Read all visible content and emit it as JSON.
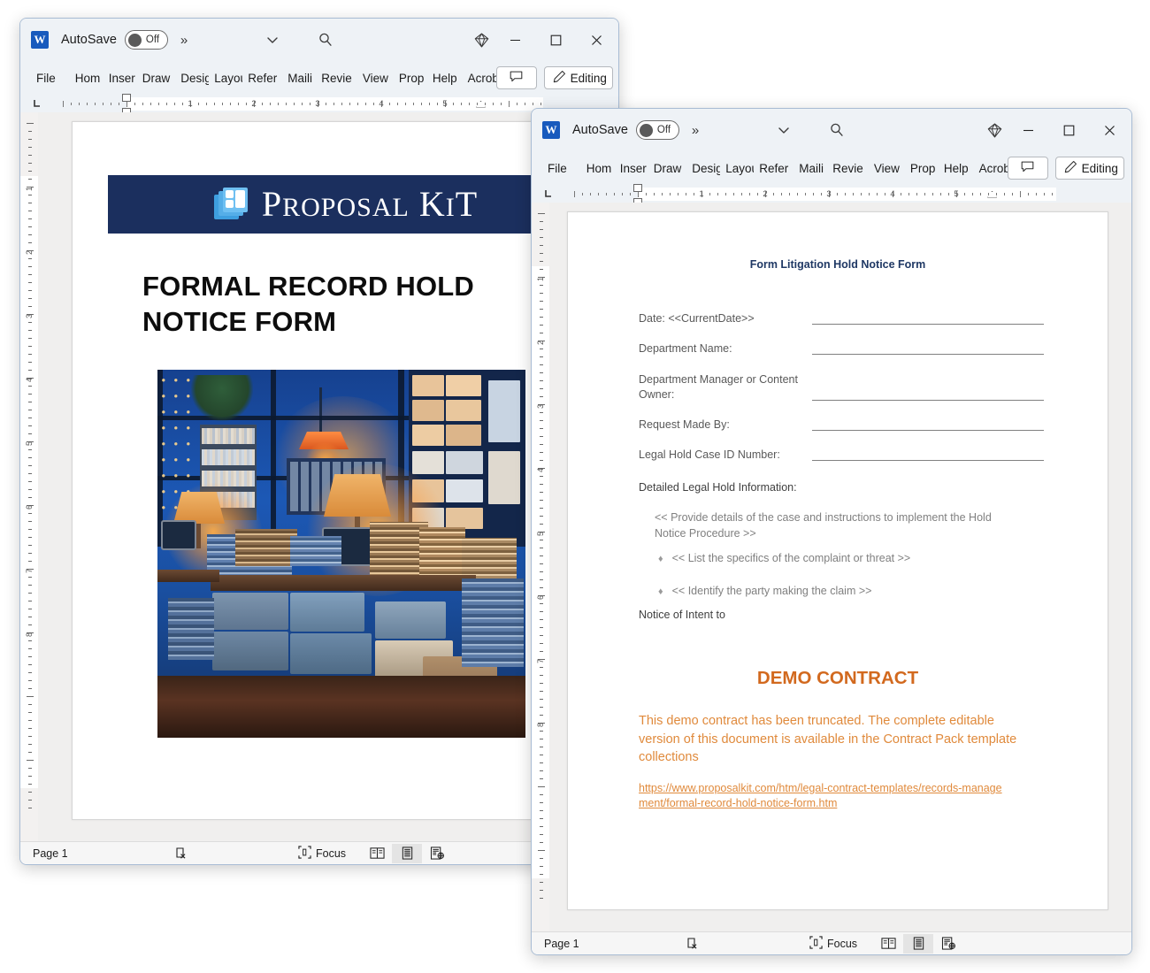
{
  "window1": {
    "titlebar": {
      "app_icon": "word-icon",
      "autosave_label": "AutoSave",
      "autosave_state": "Off",
      "overflow_chevron": "»",
      "customize_icon": "chevron-down-icon",
      "search_icon": "search-icon",
      "copilot_icon": "diamond-icon",
      "minimize_icon": "minimize-icon",
      "maximize_icon": "maximize-icon",
      "close_icon": "close-icon"
    },
    "ribbon": {
      "tabs": [
        "File",
        "Home",
        "Insert",
        "Draw",
        "Design",
        "Layout",
        "References",
        "Mailings",
        "Review",
        "View",
        "Proposal Kit",
        "Help",
        "Acrobat"
      ],
      "tabs_display": [
        "File",
        "Hom",
        "Inser",
        "Draw",
        "Desig",
        "Layou",
        "Refer",
        "Maili",
        "Revie",
        "View",
        "Prop",
        "Help",
        "Acrob"
      ],
      "comments_icon": "comment-icon",
      "editing_icon": "pencil-icon",
      "editing_label": "Editing",
      "more_chevron": "›"
    },
    "ruler": {
      "tabstop_icon": "left-tab-stop-icon",
      "numbers": [
        "1",
        "2",
        "3",
        "4",
        "5"
      ],
      "vertical_numbers": [
        "1",
        "2",
        "3",
        "4",
        "5",
        "6",
        "7",
        "8"
      ]
    },
    "document": {
      "banner_brand": "PROPOSAL KIT",
      "banner_brand_main": "P",
      "title": "FORMAL RECORD HOLD NOTICE FORM",
      "image_alt": "records-archive-photo",
      "banner_color": "#1b2f5e"
    },
    "statusbar": {
      "page_label": "Page 1",
      "spelling_icon": "proofing-icon",
      "focus_icon": "focus-icon",
      "focus_label": "Focus",
      "view_read_icon": "read-mode-icon",
      "view_print_icon": "print-layout-icon",
      "view_web_icon": "web-layout-icon"
    }
  },
  "window2": {
    "titlebar": {
      "app_icon": "word-icon",
      "autosave_label": "AutoSave",
      "autosave_state": "Off",
      "overflow_chevron": "»",
      "customize_icon": "chevron-down-icon",
      "search_icon": "search-icon",
      "copilot_icon": "diamond-icon",
      "minimize_icon": "minimize-icon",
      "maximize_icon": "maximize-icon",
      "close_icon": "close-icon"
    },
    "ribbon": {
      "tabs": [
        "File",
        "Home",
        "Insert",
        "Draw",
        "Design",
        "Layout",
        "References",
        "Mailings",
        "Review",
        "View",
        "Proposal Kit",
        "Help",
        "Acrobat"
      ],
      "tabs_display": [
        "File",
        "Hom",
        "Inser",
        "Draw",
        "Desig",
        "Layou",
        "Refer",
        "Maili",
        "Revie",
        "View",
        "Prop",
        "Help",
        "Acrob"
      ],
      "comments_icon": "comment-icon",
      "editing_icon": "pencil-icon",
      "editing_label": "Editing",
      "more_chevron": "›"
    },
    "ruler": {
      "tabstop_icon": "left-tab-stop-icon",
      "numbers": [
        "1",
        "2",
        "3",
        "4",
        "5"
      ],
      "vertical_numbers": [
        "1",
        "2",
        "3",
        "4",
        "5",
        "6",
        "7",
        "8"
      ]
    },
    "document": {
      "title": "Form Litigation Hold Notice Form",
      "title_color": "#1f3864",
      "fields": [
        {
          "label": "Date: <<CurrentDate>>"
        },
        {
          "label": "Department Name:"
        },
        {
          "label": "Department Manager or Content Owner:"
        },
        {
          "label": "Request Made By:"
        },
        {
          "label": "Legal Hold Case ID Number:"
        }
      ],
      "section_heading": "Detailed Legal Hold Information:",
      "instruction": "<< Provide details of the case and instructions to implement the Hold Notice Procedure >>",
      "bullets": [
        "<< List the specifics of the complaint or threat >>",
        "<< Identify the party making the claim >>"
      ],
      "bullet_char": "♦",
      "closing_heading": "Notice of Intent to",
      "demo_title": "DEMO CONTRACT",
      "demo_text": "This demo contract has been truncated. The complete editable version of this document is available in the Contract Pack template collections",
      "demo_link": "https://www.proposalkit.com/htm/legal-contract-templates/records-management/formal-record-hold-notice-form.htm",
      "demo_color": "#e08a3c",
      "demo_title_color": "#d2691e"
    },
    "statusbar": {
      "page_label": "Page 1",
      "spelling_icon": "proofing-icon",
      "focus_icon": "focus-icon",
      "focus_label": "Focus",
      "view_read_icon": "read-mode-icon",
      "view_print_icon": "print-layout-icon",
      "view_web_icon": "web-layout-icon"
    }
  }
}
